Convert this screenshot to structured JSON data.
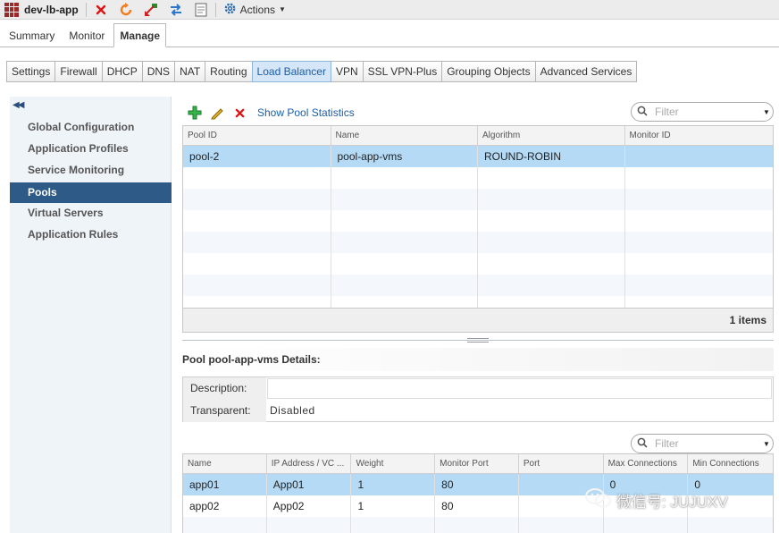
{
  "app": {
    "title": "dev-lb-app",
    "actions_label": "Actions"
  },
  "main_tabs": [
    {
      "label": "Summary"
    },
    {
      "label": "Monitor"
    },
    {
      "label": "Manage"
    }
  ],
  "sub_tabs": [
    {
      "label": "Settings"
    },
    {
      "label": "Firewall"
    },
    {
      "label": "DHCP"
    },
    {
      "label": "DNS"
    },
    {
      "label": "NAT"
    },
    {
      "label": "Routing"
    },
    {
      "label": "Load Balancer"
    },
    {
      "label": "VPN"
    },
    {
      "label": "SSL VPN-Plus"
    },
    {
      "label": "Grouping Objects"
    },
    {
      "label": "Advanced Services"
    }
  ],
  "sidebar": {
    "items": [
      {
        "label": "Global Configuration"
      },
      {
        "label": "Application Profiles"
      },
      {
        "label": "Service Monitoring"
      },
      {
        "label": "Pools"
      },
      {
        "label": "Virtual Servers"
      },
      {
        "label": "Application Rules"
      }
    ]
  },
  "pool_toolbar": {
    "show_stats_label": "Show Pool Statistics",
    "filter_placeholder": "Filter"
  },
  "pools_table": {
    "columns": [
      "Pool ID",
      "Name",
      "Algorithm",
      "Monitor ID"
    ],
    "rows": [
      {
        "pool_id": "pool-2",
        "name": "pool-app-vms",
        "algorithm": "ROUND-ROBIN",
        "monitor_id": ""
      }
    ],
    "footer": "1 items"
  },
  "details": {
    "title": "Pool pool-app-vms Details:",
    "description_label": "Description:",
    "description_value": "",
    "transparent_label": "Transparent:",
    "transparent_value": "Disabled"
  },
  "members_filter_placeholder": "Filter",
  "members_table": {
    "columns": [
      "Name",
      "IP Address / VC ...",
      "Weight",
      "Monitor Port",
      "Port",
      "Max Connections",
      "Min Connections"
    ],
    "rows": [
      {
        "name": "app01",
        "ip": "App01",
        "weight": "1",
        "monitor_port": "80",
        "port": "",
        "max": "0",
        "min": "0"
      },
      {
        "name": "app02",
        "ip": "App02",
        "weight": "1",
        "monitor_port": "80",
        "port": "",
        "max": "",
        "min": ""
      }
    ]
  },
  "watermark": {
    "text": "微信号: JUJUXV"
  }
}
